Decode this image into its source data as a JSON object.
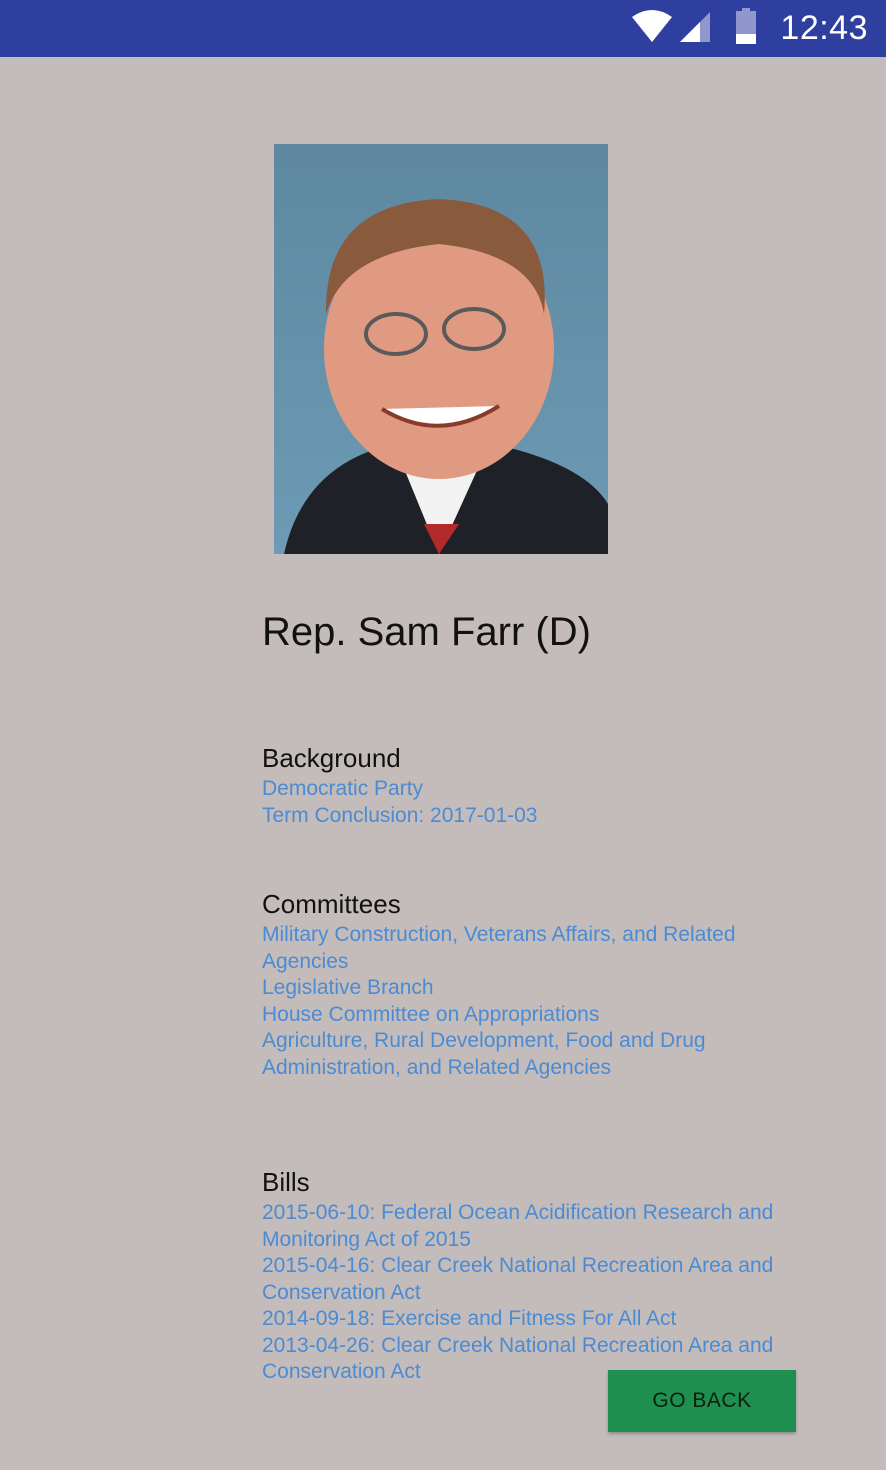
{
  "status_bar": {
    "time": "12:43"
  },
  "profile": {
    "photo_alt": "Portrait of Rep. Sam Farr",
    "name": "Rep. Sam Farr (D)"
  },
  "background": {
    "heading": "Background",
    "items": [
      "Democratic Party",
      "Term Conclusion: 2017-01-03"
    ]
  },
  "committees": {
    "heading": "Committees",
    "items": [
      "Military Construction, Veterans Affairs, and Related",
      "Agencies",
      "Legislative Branch",
      "House Committee on Appropriations",
      "Agriculture, Rural Development, Food and Drug",
      "Administration, and Related Agencies"
    ]
  },
  "bills": {
    "heading": "Bills",
    "items": [
      "2015-06-10: Federal Ocean Acidification Research and",
      "Monitoring Act of 2015",
      "2015-04-16: Clear Creek National Recreation Area and",
      "Conservation Act",
      "2014-09-18: Exercise and Fitness For All Act",
      "2013-04-26: Clear Creek National Recreation Area and",
      "Conservation Act"
    ]
  },
  "actions": {
    "go_back_label": "GO BACK"
  },
  "colors": {
    "status_bar": "#2f3fa0",
    "background": "#c4bcbb",
    "link": "#4a8bd4",
    "button": "#1f8f4f"
  }
}
